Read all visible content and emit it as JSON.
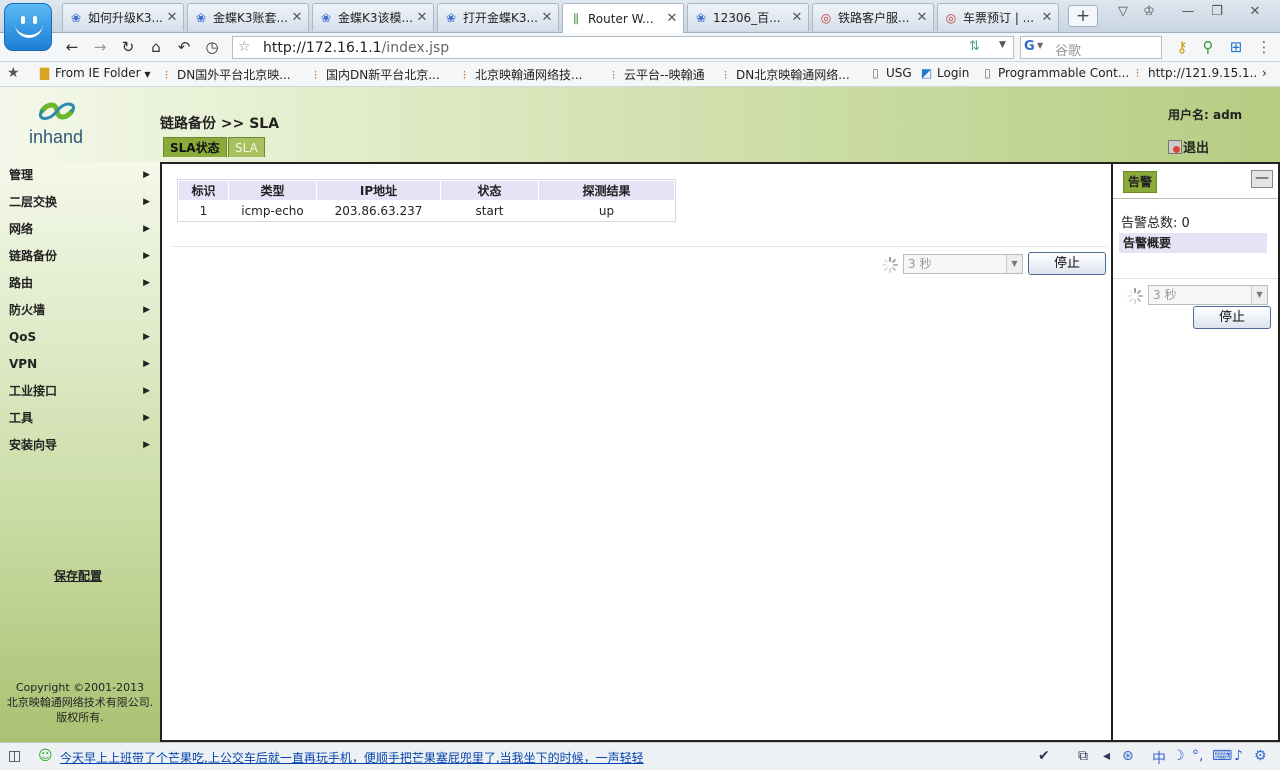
{
  "browser": {
    "tabs": [
      {
        "label": "如何升级K3...",
        "icon": "paw-icon"
      },
      {
        "label": "金蝶K3账套...",
        "icon": "paw-icon"
      },
      {
        "label": "金蝶K3该模...",
        "icon": "paw-icon"
      },
      {
        "label": "打开金蝶K3...",
        "icon": "paw-icon"
      },
      {
        "label": "Router W...",
        "icon": "router-icon",
        "active": true
      },
      {
        "label": "12306_百...",
        "icon": "paw-icon"
      },
      {
        "label": "铁路客户服...",
        "icon": "railway-icon"
      },
      {
        "label": "车票预订 | ...",
        "icon": "railway-icon"
      }
    ],
    "url_host": "http://172.16.1.1",
    "url_path": "/index.jsp",
    "search_placeholder": "谷歌",
    "bookmarks": [
      "From IE Folder",
      "DN国外平台北京映...",
      "国内DN新平台北京...",
      "北京映翰通网络技...",
      "云平台--映翰通",
      "DN北京映翰通网络...",
      "USG",
      "Login",
      "Programmable Cont...",
      "http://121.9.15.1..."
    ],
    "status_message": "今天早上上班带了个芒果吃,上公交车后就一直再玩手机，便顺手把芒果塞屁兜里了,当我坐下的时候，一声轻轻"
  },
  "header": {
    "brand": "inhand",
    "breadcrumb": "链路备份 >> SLA",
    "tabs": [
      "SLA状态",
      "SLA"
    ],
    "user_label": "用户名: adm",
    "logout_label": "退出"
  },
  "sidebar": {
    "items": [
      "管理",
      "二层交换",
      "网络",
      "链路备份",
      "路由",
      "防火墙",
      "QoS",
      "VPN",
      "工业接口",
      "工具",
      "安装向导"
    ],
    "save_label": "保存配置",
    "copyright_1": "Copyright ©2001-2013",
    "copyright_2": "北京映翰通网络技术有限公司.",
    "copyright_3": "版权所有."
  },
  "sla_table": {
    "headers": [
      "标识",
      "类型",
      "IP地址",
      "状态",
      "探测结果"
    ],
    "rows": [
      [
        "1",
        "icmp-echo",
        "203.86.63.237",
        "start",
        "up"
      ]
    ]
  },
  "refresh": {
    "interval": "3 秒",
    "stop_label": "停止"
  },
  "alerts": {
    "tab_label": "告警",
    "collapse_label": "—",
    "total_label": "告警总数: 0",
    "summary_label": "告警概要",
    "interval": "3 秒",
    "stop_label": "停止"
  }
}
